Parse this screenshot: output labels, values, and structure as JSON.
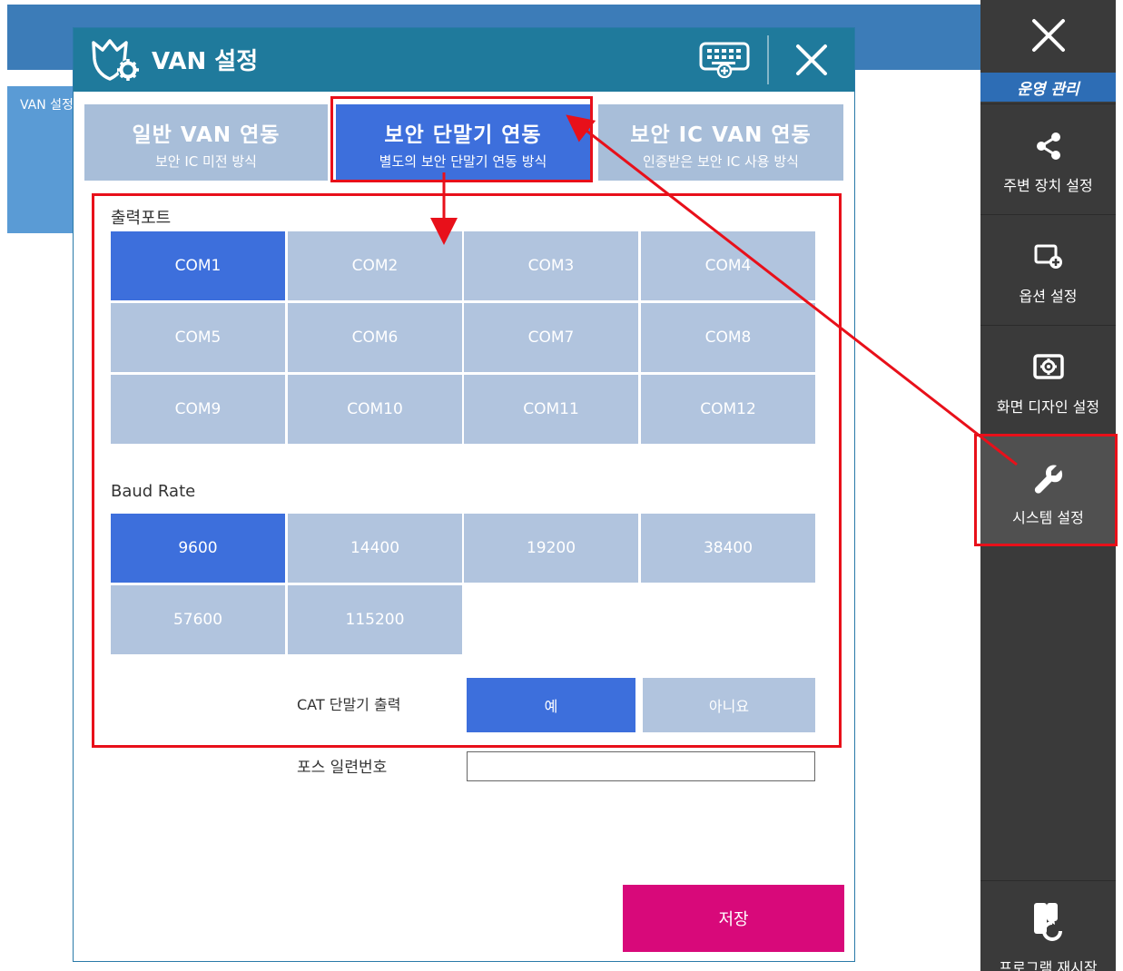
{
  "background": {
    "left_tab_label": "VAN 설정"
  },
  "sidebar": {
    "close_icon": "close-icon",
    "header": "운영 관리",
    "items": [
      {
        "label": "주변 장치 설정",
        "icon": "share-icon"
      },
      {
        "label": "옵션 설정",
        "icon": "screen-plus-icon"
      },
      {
        "label": "화면 디자인 설정",
        "icon": "monitor-gear-icon"
      },
      {
        "label": "시스템 설정",
        "icon": "wrench-icon",
        "active": true
      }
    ],
    "bottom": {
      "label": "프로그램 재시작",
      "icon": "restart-icon"
    }
  },
  "dialog": {
    "title": "VAN 설정",
    "tabs": [
      {
        "title": "일반 VAN 연동",
        "subtitle": "보안 IC 미전 방식",
        "active": false
      },
      {
        "title": "보안 단말기 연동",
        "subtitle": "별도의 보안 단말기 연동 방식",
        "active": true
      },
      {
        "title": "보안 IC VAN 연동",
        "subtitle": "인증받은 보안 IC 사용 방식",
        "active": false
      }
    ],
    "port_section": {
      "label": "출력포트",
      "options": [
        "COM1",
        "COM2",
        "COM3",
        "COM4",
        "COM5",
        "COM6",
        "COM7",
        "COM8",
        "COM9",
        "COM10",
        "COM11",
        "COM12"
      ],
      "selected": "COM1"
    },
    "baud_section": {
      "label": "Baud Rate",
      "options": [
        "9600",
        "14400",
        "19200",
        "38400",
        "57600",
        "115200"
      ],
      "selected": "9600"
    },
    "cat_output": {
      "label": "CAT 단말기 출력",
      "yes": "예",
      "no": "아니요",
      "selected": "예"
    },
    "pos_serial": {
      "label": "포스 일련번호",
      "value": ""
    },
    "save_label": "저장"
  },
  "colors": {
    "selected": "#3d6fdc",
    "unselected": "#b1c4de",
    "title_bar": "#1f7a9c",
    "save": "#d8097a",
    "sidebar": "#3a3a3a",
    "annotation": "#e8101a"
  }
}
